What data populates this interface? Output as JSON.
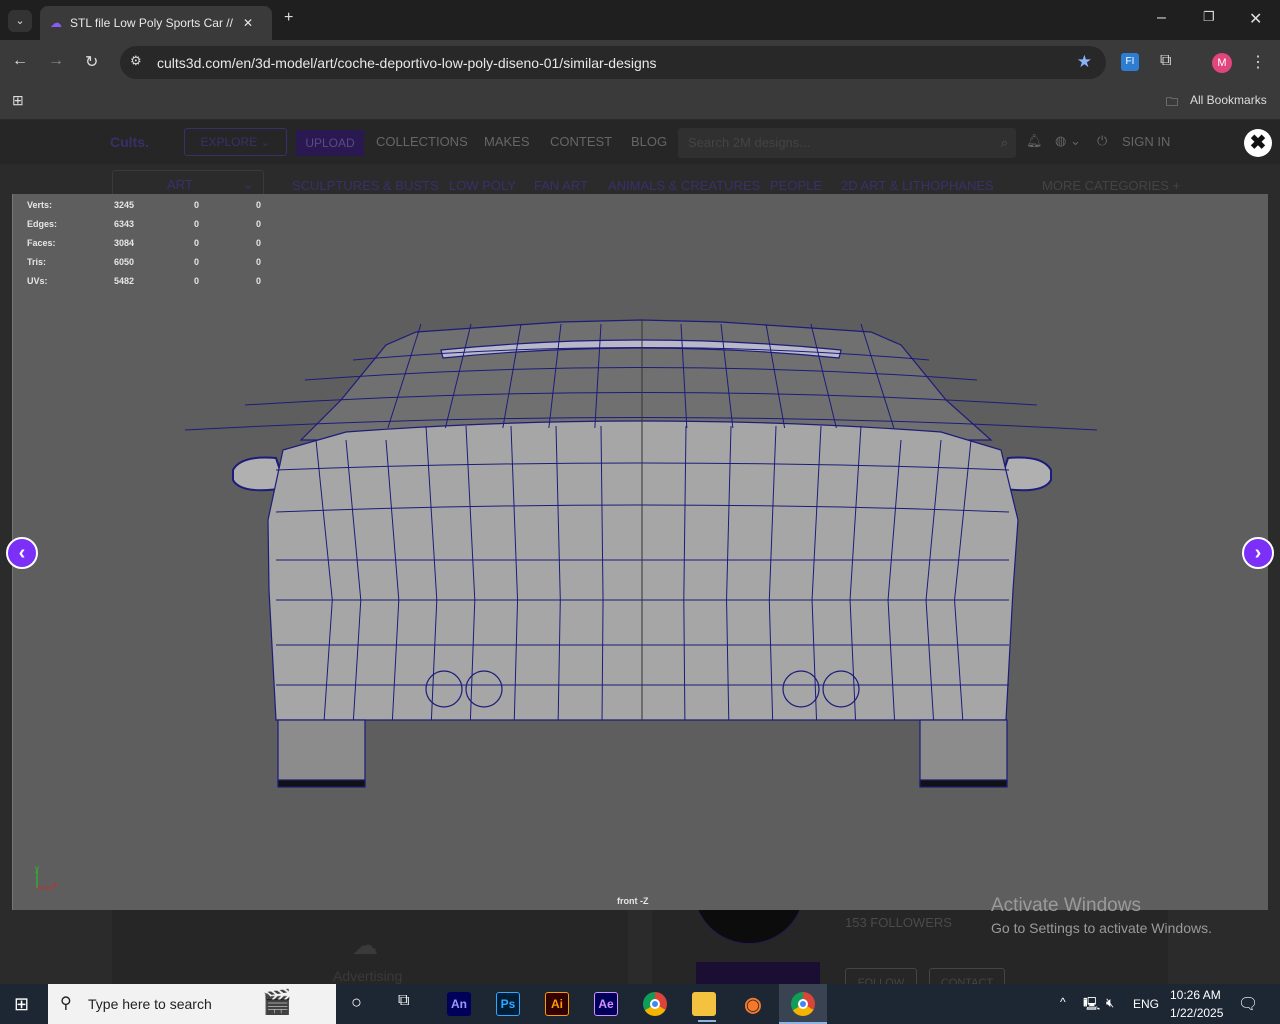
{
  "browser": {
    "tab_title": "STL file Low Poly Sports Car // D",
    "url": "cults3d.com/en/3d-model/art/coche-deportivo-low-poly-diseno-01/similar-designs",
    "bookmarks_label": "All Bookmarks",
    "profile_initial": "M"
  },
  "site": {
    "logo": "Cults.",
    "explore": "EXPLORE",
    "upload": "UPLOAD",
    "nav": [
      "COLLECTIONS",
      "MAKES",
      "CONTEST",
      "BLOG"
    ],
    "search_placeholder": "Search 2M designs...",
    "sign_in": "SIGN IN",
    "category_select": "ART",
    "categories": [
      "SCULPTURES & BUSTS",
      "LOW POLY",
      "FAN ART",
      "ANIMALS & CREATURES",
      "PEOPLE",
      "2D ART & LITHOPHANES"
    ],
    "more_categories": "MORE CATEGORIES +",
    "followers": "153 FOLLOWERS",
    "follow": "FOLLOW",
    "contact": "CONTACT",
    "advertising": "Advertising"
  },
  "viewer": {
    "stats": [
      {
        "label": "Verts:",
        "v": [
          "3245",
          "0",
          "0"
        ]
      },
      {
        "label": "Edges:",
        "v": [
          "6343",
          "0",
          "0"
        ]
      },
      {
        "label": "Faces:",
        "v": [
          "3084",
          "0",
          "0"
        ]
      },
      {
        "label": "Tris:",
        "v": [
          "6050",
          "0",
          "0"
        ]
      },
      {
        "label": "UVs:",
        "v": [
          "5482",
          "0",
          "0"
        ]
      }
    ],
    "view_label": "front -Z",
    "axis_y": "y",
    "axis_x": "x",
    "wire_color": "#1c1c7a"
  },
  "watermark": {
    "title": "Activate Windows",
    "subtitle": "Go to Settings to activate Windows."
  },
  "taskbar": {
    "search": "Type here to search",
    "apps": [
      "An",
      "Ps",
      "Ai",
      "Ae"
    ],
    "lang": "ENG",
    "time": "10:26 AM",
    "date": "1/22/2025"
  }
}
